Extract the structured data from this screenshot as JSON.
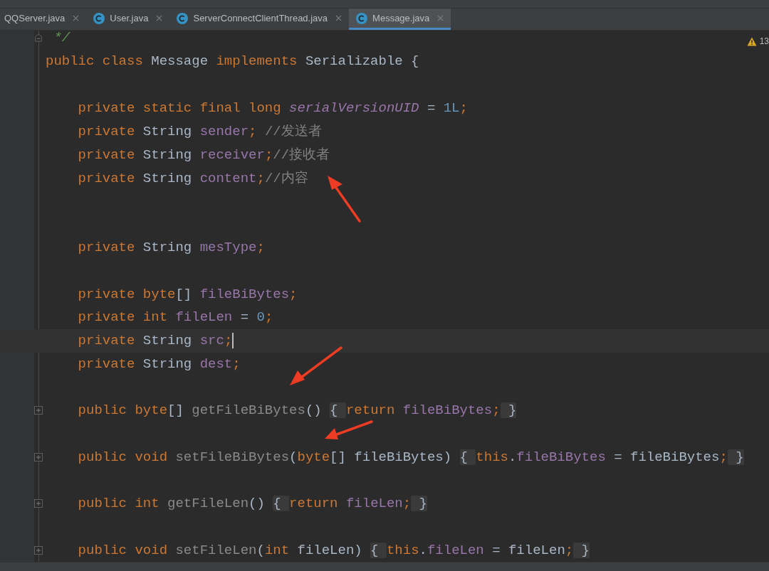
{
  "tabs": [
    {
      "label": "QQServer.java",
      "icon": false,
      "selected": false
    },
    {
      "label": "User.java",
      "icon": true,
      "selected": false
    },
    {
      "label": "ServerConnectClientThread.java",
      "icon": true,
      "selected": false
    },
    {
      "label": "Message.java",
      "icon": true,
      "selected": true
    }
  ],
  "warnings": {
    "count": "13"
  },
  "lines": [
    {
      "kind": "code",
      "fold_end": true,
      "tokens": [
        {
          "kind": "doc",
          "text": " */"
        }
      ]
    },
    {
      "kind": "code",
      "tokens": [
        {
          "kind": "kw",
          "text": "public class "
        },
        {
          "kind": "plain",
          "text": "Message "
        },
        {
          "kind": "kw",
          "text": "implements "
        },
        {
          "kind": "plain",
          "text": "Serializable {"
        }
      ]
    },
    {
      "kind": "blank"
    },
    {
      "kind": "code",
      "tokens": [
        {
          "kind": "kw",
          "text": "    private static final long "
        },
        {
          "kind": "static",
          "text": "serialVersionUID"
        },
        {
          "kind": "plain",
          "text": " = "
        },
        {
          "kind": "num",
          "text": "1L"
        },
        {
          "kind": "kw",
          "text": ";"
        }
      ]
    },
    {
      "kind": "code",
      "tokens": [
        {
          "kind": "kw",
          "text": "    private "
        },
        {
          "kind": "plain",
          "text": "String "
        },
        {
          "kind": "field",
          "text": "sender"
        },
        {
          "kind": "kw",
          "text": "; "
        },
        {
          "kind": "comment",
          "text": "//发送者"
        }
      ]
    },
    {
      "kind": "code",
      "tokens": [
        {
          "kind": "kw",
          "text": "    private "
        },
        {
          "kind": "plain",
          "text": "String "
        },
        {
          "kind": "field",
          "text": "receiver"
        },
        {
          "kind": "kw",
          "text": ";"
        },
        {
          "kind": "comment",
          "text": "//接收者"
        }
      ]
    },
    {
      "kind": "code",
      "tokens": [
        {
          "kind": "kw",
          "text": "    private "
        },
        {
          "kind": "plain",
          "text": "String "
        },
        {
          "kind": "field",
          "text": "content"
        },
        {
          "kind": "kw",
          "text": ";"
        },
        {
          "kind": "comment",
          "text": "//内容"
        }
      ]
    },
    {
      "kind": "blank"
    },
    {
      "kind": "blank"
    },
    {
      "kind": "code",
      "tokens": [
        {
          "kind": "kw",
          "text": "    private "
        },
        {
          "kind": "plain",
          "text": "String "
        },
        {
          "kind": "field",
          "text": "mesType"
        },
        {
          "kind": "kw",
          "text": ";"
        }
      ]
    },
    {
      "kind": "blank"
    },
    {
      "kind": "code",
      "tokens": [
        {
          "kind": "kw",
          "text": "    private byte"
        },
        {
          "kind": "plain",
          "text": "[] "
        },
        {
          "kind": "field",
          "text": "fileBiBytes"
        },
        {
          "kind": "kw",
          "text": ";"
        }
      ]
    },
    {
      "kind": "code",
      "tokens": [
        {
          "kind": "kw",
          "text": "    private int "
        },
        {
          "kind": "field",
          "text": "fileLen"
        },
        {
          "kind": "plain",
          "text": " = "
        },
        {
          "kind": "num",
          "text": "0"
        },
        {
          "kind": "kw",
          "text": ";"
        }
      ]
    },
    {
      "kind": "code",
      "current": true,
      "tokens": [
        {
          "kind": "kw",
          "text": "    private "
        },
        {
          "kind": "plain",
          "text": "String "
        },
        {
          "kind": "field",
          "text": "src"
        },
        {
          "kind": "kw",
          "text": ";"
        }
      ]
    },
    {
      "kind": "code",
      "tokens": [
        {
          "kind": "kw",
          "text": "    private "
        },
        {
          "kind": "plain",
          "text": "String "
        },
        {
          "kind": "field",
          "text": "dest"
        },
        {
          "kind": "kw",
          "text": ";"
        }
      ]
    },
    {
      "kind": "blank"
    },
    {
      "kind": "code",
      "collapsed": true,
      "tokens": [
        {
          "kind": "kw",
          "text": "    public byte"
        },
        {
          "kind": "plain",
          "text": "[] "
        },
        {
          "kind": "method",
          "text": "getFileBiBytes"
        },
        {
          "kind": "plain",
          "text": "() "
        },
        {
          "kind": "fold",
          "text": "{ "
        },
        {
          "kind": "kw",
          "text": "return "
        },
        {
          "kind": "field",
          "text": "fileBiBytes"
        },
        {
          "kind": "kw",
          "text": ";"
        },
        {
          "kind": "fold",
          "text": " }"
        }
      ]
    },
    {
      "kind": "blank"
    },
    {
      "kind": "code",
      "collapsed": true,
      "tokens": [
        {
          "kind": "kw",
          "text": "    public void "
        },
        {
          "kind": "method",
          "text": "setFileBiBytes"
        },
        {
          "kind": "plain",
          "text": "("
        },
        {
          "kind": "kw",
          "text": "byte"
        },
        {
          "kind": "plain",
          "text": "[] fileBiBytes) "
        },
        {
          "kind": "fold",
          "text": "{ "
        },
        {
          "kind": "kw",
          "text": "this"
        },
        {
          "kind": "plain",
          "text": "."
        },
        {
          "kind": "field",
          "text": "fileBiBytes"
        },
        {
          "kind": "plain",
          "text": " = fileBiBytes"
        },
        {
          "kind": "kw",
          "text": ";"
        },
        {
          "kind": "fold",
          "text": " }"
        }
      ]
    },
    {
      "kind": "blank"
    },
    {
      "kind": "code",
      "collapsed": true,
      "tokens": [
        {
          "kind": "kw",
          "text": "    public int "
        },
        {
          "kind": "method",
          "text": "getFileLen"
        },
        {
          "kind": "plain",
          "text": "() "
        },
        {
          "kind": "fold",
          "text": "{ "
        },
        {
          "kind": "kw",
          "text": "return "
        },
        {
          "kind": "field",
          "text": "fileLen"
        },
        {
          "kind": "kw",
          "text": ";"
        },
        {
          "kind": "fold",
          "text": " }"
        }
      ]
    },
    {
      "kind": "blank"
    },
    {
      "kind": "code",
      "collapsed": true,
      "tokens": [
        {
          "kind": "kw",
          "text": "    public void "
        },
        {
          "kind": "method",
          "text": "setFileLen"
        },
        {
          "kind": "plain",
          "text": "("
        },
        {
          "kind": "kw",
          "text": "int "
        },
        {
          "kind": "plain",
          "text": "fileLen) "
        },
        {
          "kind": "fold",
          "text": "{ "
        },
        {
          "kind": "kw",
          "text": "this"
        },
        {
          "kind": "plain",
          "text": "."
        },
        {
          "kind": "field",
          "text": "fileLen"
        },
        {
          "kind": "plain",
          "text": " = fileLen"
        },
        {
          "kind": "kw",
          "text": ";"
        },
        {
          "kind": "fold",
          "text": " }"
        }
      ]
    }
  ]
}
